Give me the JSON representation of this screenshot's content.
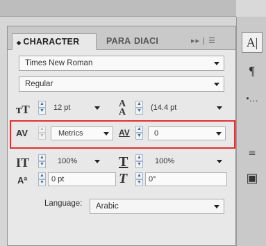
{
  "tabs": [
    {
      "label": "CHARACTER",
      "active": true
    },
    {
      "label": "PARA",
      "active": false
    },
    {
      "label": "DIACI",
      "active": false
    }
  ],
  "tab_controls": "▸▸ | ☰",
  "font_family": "Times New Roman",
  "font_style": "Regular",
  "font_size": "12 pt",
  "leading": "(14.4 pt",
  "kerning": "Metrics",
  "tracking": "0",
  "vertical_scale": "100%",
  "horizontal_scale": "100%",
  "baseline_shift": "0 pt",
  "skew": "0°",
  "language_label": "Language:",
  "language": "Arabic",
  "highlight_color": "#e03030",
  "icons": {
    "font_size": "font-size-icon",
    "leading": "leading-icon",
    "kerning": "kerning-icon",
    "tracking": "tracking-icon",
    "vertical_scale": "vertical-scale-icon",
    "horizontal_scale": "horizontal-scale-icon",
    "baseline_shift": "baseline-shift-icon",
    "skew": "skew-icon"
  },
  "dock": {
    "character": "A|",
    "paragraph": "¶",
    "glyph": "•…",
    "align": "≡",
    "pathfinder": "▣"
  }
}
